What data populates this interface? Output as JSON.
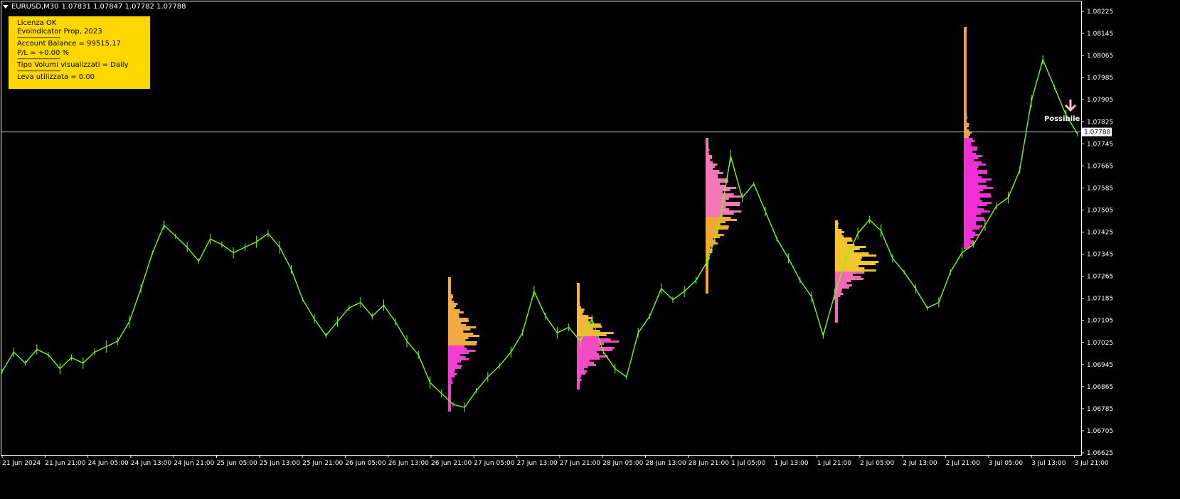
{
  "header": {
    "symbol": "EURUSD,M30",
    "ohlc": "1.07831 1.07847 1.07782 1.07788"
  },
  "info_panel": {
    "line1": "Licenza OK",
    "line2": "Evoindicator Prop, 2023",
    "sep": "--------------------------------",
    "balance": "Account Balance = 99515.17",
    "pl": "P/L  = +0.00 %",
    "volume_type": "Tipo Volumi visualizzati = Daily",
    "leverage": "Leva utilizzata = 0.00"
  },
  "signal": {
    "label": "Possibile",
    "arrow_color": "#FFC0CB"
  },
  "current_price": "1.07788",
  "colors": {
    "background": "#000000",
    "candles": "#7CFC00",
    "panel": "#FFD700",
    "profile_high": "#FFD700",
    "profile_low": "#FF00FF"
  },
  "chart_data": {
    "type": "line",
    "y_axis_ticks": [
      "1.08225",
      "1.08145",
      "1.08065",
      "1.07985",
      "1.07905",
      "1.07825",
      "1.07745",
      "1.07665",
      "1.07585",
      "1.07505",
      "1.07425",
      "1.07345",
      "1.07265",
      "1.07185",
      "1.07105",
      "1.07025",
      "1.06945",
      "1.06865",
      "1.06785",
      "1.06705",
      "1.06625"
    ],
    "x_axis_ticks": [
      "21 Jun 2024",
      "21 Jun 21:00",
      "24 Jun 05:00",
      "24 Jun 13:00",
      "24 Jun 21:00",
      "25 Jun 05:00",
      "25 Jun 13:00",
      "25 Jun 21:00",
      "26 Jun 05:00",
      "26 Jun 13:00",
      "26 Jun 21:00",
      "27 Jun 05:00",
      "27 Jun 13:00",
      "27 Jun 21:00",
      "28 Jun 05:00",
      "28 Jun 13:00",
      "28 Jun 21:00",
      "1 Jul 05:00",
      "1 Jul 13:00",
      "1 Jul 21:00",
      "2 Jul 05:00",
      "2 Jul 13:00",
      "2 Jul 21:00",
      "3 Jul 05:00",
      "3 Jul 13:00",
      "3 Jul 21:00"
    ],
    "ylim": [
      1.06625,
      1.08225
    ],
    "series": [
      {
        "values": [
          1.0692,
          1.0699,
          1.0695,
          1.07,
          1.0698,
          1.0693,
          1.0697,
          1.0695,
          1.0699,
          1.0701,
          1.0703,
          1.071,
          1.0722,
          1.0735,
          1.0745,
          1.0741,
          1.0737,
          1.0732,
          1.074,
          1.0738,
          1.0735,
          1.0737,
          1.0739,
          1.0742,
          1.0737,
          1.0729,
          1.0718,
          1.0711,
          1.0705,
          1.071,
          1.0715,
          1.0717,
          1.0712,
          1.0716,
          1.071,
          1.0703,
          1.0698,
          1.0688,
          1.0684,
          1.068,
          1.0679,
          1.0685,
          1.069,
          1.0694,
          1.0699,
          1.0706,
          1.0721,
          1.0712,
          1.0706,
          1.0708,
          1.0703,
          1.0711,
          1.0699,
          1.0693,
          1.069,
          1.0706,
          1.0712,
          1.0722,
          1.0718,
          1.0721,
          1.0725,
          1.0732,
          1.0745,
          1.077,
          1.0755,
          1.076,
          1.075,
          1.074,
          1.0733,
          1.0725,
          1.0719,
          1.0705,
          1.072,
          1.0733,
          1.0742,
          1.0747,
          1.0743,
          1.0733,
          1.0728,
          1.0722,
          1.0715,
          1.0717,
          1.0728,
          1.0735,
          1.0738,
          1.0745,
          1.0752,
          1.0755,
          1.0765,
          1.079,
          1.0805,
          1.0795,
          1.0785,
          1.0778
        ]
      }
    ]
  }
}
